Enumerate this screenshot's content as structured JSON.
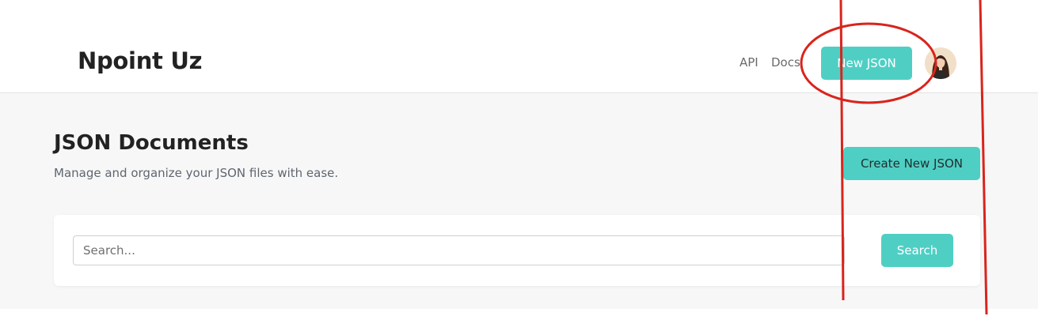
{
  "header": {
    "brand": "Npoint Uz",
    "nav": [
      {
        "label": "API"
      },
      {
        "label": "Docs"
      }
    ],
    "new_button_label": "New JSON",
    "avatar_icon": "user-avatar-icon"
  },
  "page": {
    "title": "JSON Documents",
    "subtitle": "Manage and organize your JSON files with ease.",
    "create_button_label": "Create New JSON"
  },
  "search": {
    "placeholder": "Search...",
    "value": "",
    "button_label": "Search"
  },
  "colors": {
    "accent": "#4fcfc4",
    "annotation_red": "#d9241c",
    "page_background": "#f7f7f7"
  }
}
